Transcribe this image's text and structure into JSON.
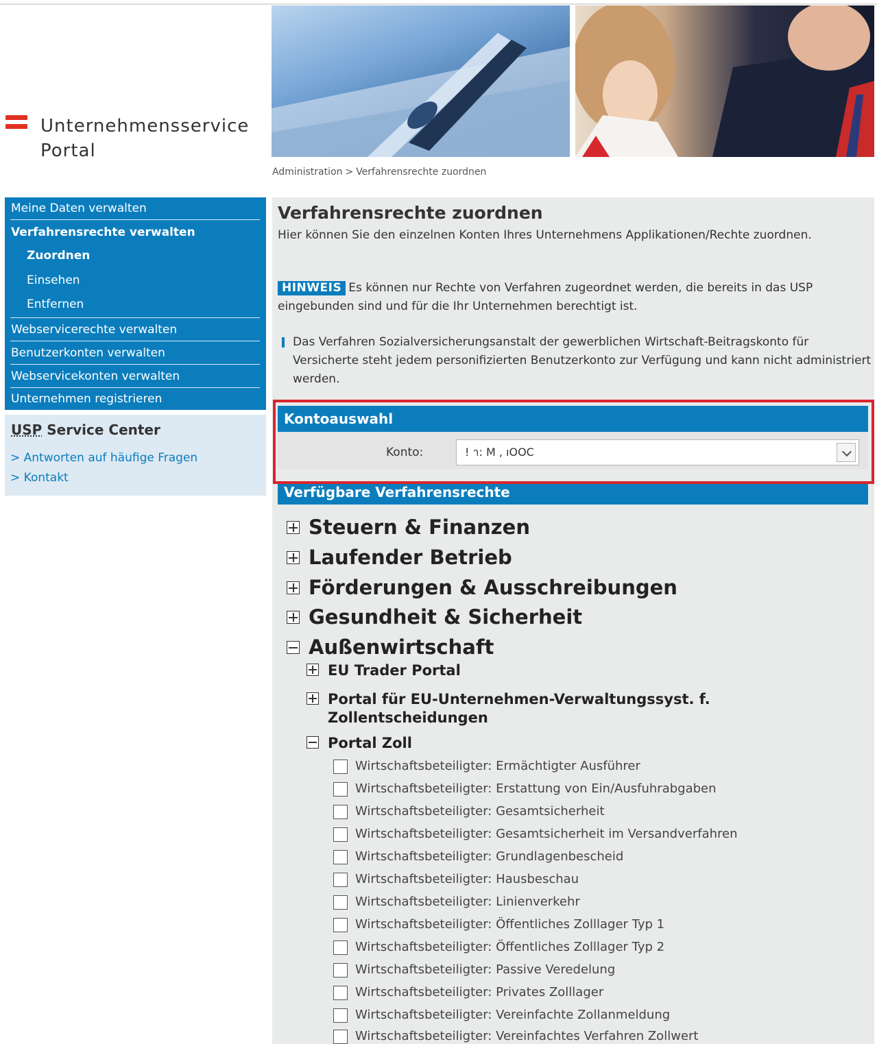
{
  "logo": {
    "line1": "Unternehmensservice",
    "line2": "Portal"
  },
  "breadcrumb": {
    "parent": "Administration",
    "separator": ">",
    "current": "Verfahrensrechte zuordnen"
  },
  "nav": {
    "items": [
      {
        "label": "Meine Daten verwalten"
      },
      {
        "label": "Verfahrensrechte verwalten"
      },
      {
        "label": "Zuordnen"
      },
      {
        "label": "Einsehen"
      },
      {
        "label": "Entfernen"
      },
      {
        "label": "Webservicerechte verwalten"
      },
      {
        "label": "Benutzerkonten verwalten"
      },
      {
        "label": "Webservicekonten verwalten"
      },
      {
        "label": "Unternehmen registrieren"
      }
    ]
  },
  "service_center": {
    "title_usp": "USP",
    "title_rest": "Service Center",
    "links": [
      "> Antworten auf häufige Fragen",
      "> Kontakt"
    ]
  },
  "main": {
    "title": "Verfahrensrechte zuordnen",
    "intro": "Hier können Sie den einzelnen Konten Ihres Unternehmens Applikationen/Rechte zuordnen.",
    "hint_badge": "HINWEIS",
    "hint_text": "Es können nur Rechte von Verfahren zugeordnet werden, die bereits in das USP eingebunden sind und für die Ihr Unternehmen berechtigt ist.",
    "info_text": "Das Verfahren Sozialversicherungsanstalt der gewerblichen Wirtschaft-Beitragskonto für Versicherte steht jedem personifizierten Benutzerkonto zur Verfügung und kann nicht administriert werden."
  },
  "kontoauswahl": {
    "header": "Kontoauswahl",
    "label": "Konto:",
    "selected_value": "!                    า: M                      ,   ıOOC"
  },
  "verfahrensrechte": {
    "header": "Verfügbare Verfahrensrechte",
    "categories": [
      "Steuern & Finanzen",
      "Laufender Betrieb",
      "Förderungen & Ausschreibungen",
      "Gesundheit & Sicherheit",
      "Außenwirtschaft"
    ],
    "subcategories": [
      "EU Trader Portal",
      "Portal für EU-Unternehmen-Verwaltungssyst. f.",
      "Zollentscheidungen",
      "Portal Zoll"
    ],
    "rights": [
      "Wirtschaftsbeteiligter: Ermächtigter Ausführer",
      "Wirtschaftsbeteiligter: Erstattung von Ein/Ausfuhrabgaben",
      "Wirtschaftsbeteiligter: Gesamtsicherheit",
      "Wirtschaftsbeteiligter: Gesamtsicherheit im Versandverfahren",
      "Wirtschaftsbeteiligter: Grundlagenbescheid",
      "Wirtschaftsbeteiligter: Hausbeschau",
      "Wirtschaftsbeteiligter: Linienverkehr",
      "Wirtschaftsbeteiligter: Öffentliches Zolllager Typ 1",
      "Wirtschaftsbeteiligter: Öffentliches Zolllager Typ 2",
      "Wirtschaftsbeteiligter: Passive Veredelung",
      "Wirtschaftsbeteiligter: Privates Zolllager",
      "Wirtschaftsbeteiligter: Vereinfachte Zollanmeldung",
      "Wirtschaftsbeteiligter: Vereinfachtes Verfahren Zollwert"
    ]
  }
}
